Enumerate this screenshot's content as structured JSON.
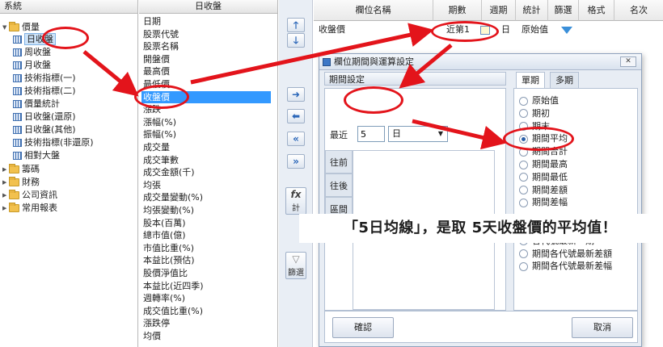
{
  "tree": {
    "header": "系統",
    "root_label": "價量",
    "items": [
      "日收盤",
      "周收盤",
      "月收盤",
      "技術指標(一)",
      "技術指標(二)",
      "價量統計",
      "日收盤(還原)",
      "日收盤(其他)",
      "技術指標(非還原)",
      "相對大盤"
    ],
    "folders": [
      "籌碼",
      "財務",
      "公司資訊",
      "常用報表"
    ]
  },
  "fields": {
    "header": "日收盤",
    "items": [
      "日期",
      "股票代號",
      "股票名稱",
      "開盤價",
      "最高價",
      "最低價",
      "收盤價",
      "漲跌",
      "漲幅(%)",
      "振幅(%)",
      "成交量",
      "成交筆數",
      "成交金額(千)",
      "均張",
      "成交量變動(%)",
      "均張變動(%)",
      "股本(百萬)",
      "總市值(億)",
      "市值比重(%)",
      "本益比(預估)",
      "股價淨值比",
      "本益比(近四季)",
      "週轉率(%)",
      "成交值比重(%)",
      "漲跌停",
      "均價"
    ]
  },
  "tools": {
    "calc_label": "計",
    "calc_symbol": "fx",
    "filter_label": "篩選"
  },
  "grid": {
    "columns": [
      "欄位名稱",
      "期數",
      "週期",
      "統計",
      "篩選",
      "格式",
      "名次"
    ],
    "row": {
      "name": "收盤價",
      "periods": "近第1",
      "cycle": "日",
      "stat": "原始值"
    }
  },
  "dialog": {
    "title": "欄位期間與運算設定",
    "close": "✕",
    "period_section": "期間設定",
    "recent_label": "最近",
    "recent_value": "5",
    "unit_value": "日",
    "side_tabs": [
      "往前",
      "往後",
      "區間"
    ],
    "tabs": [
      "單期",
      "多期"
    ],
    "options": [
      "原始值",
      "期初",
      "期末",
      "期間平均",
      "期間合計",
      "期間最高",
      "期間最低",
      "期間差額",
      "期間差幅",
      "",
      "",
      "各代號最新一期",
      "期間各代號最新差額",
      "期間各代號最新差幅"
    ],
    "selected_option": "期間平均",
    "ok": "確認",
    "cancel": "取消"
  },
  "annotation": {
    "banner": "「5日均線」，是取 5天收盤價的平均值！",
    "arrow_color": "#e3141b"
  }
}
